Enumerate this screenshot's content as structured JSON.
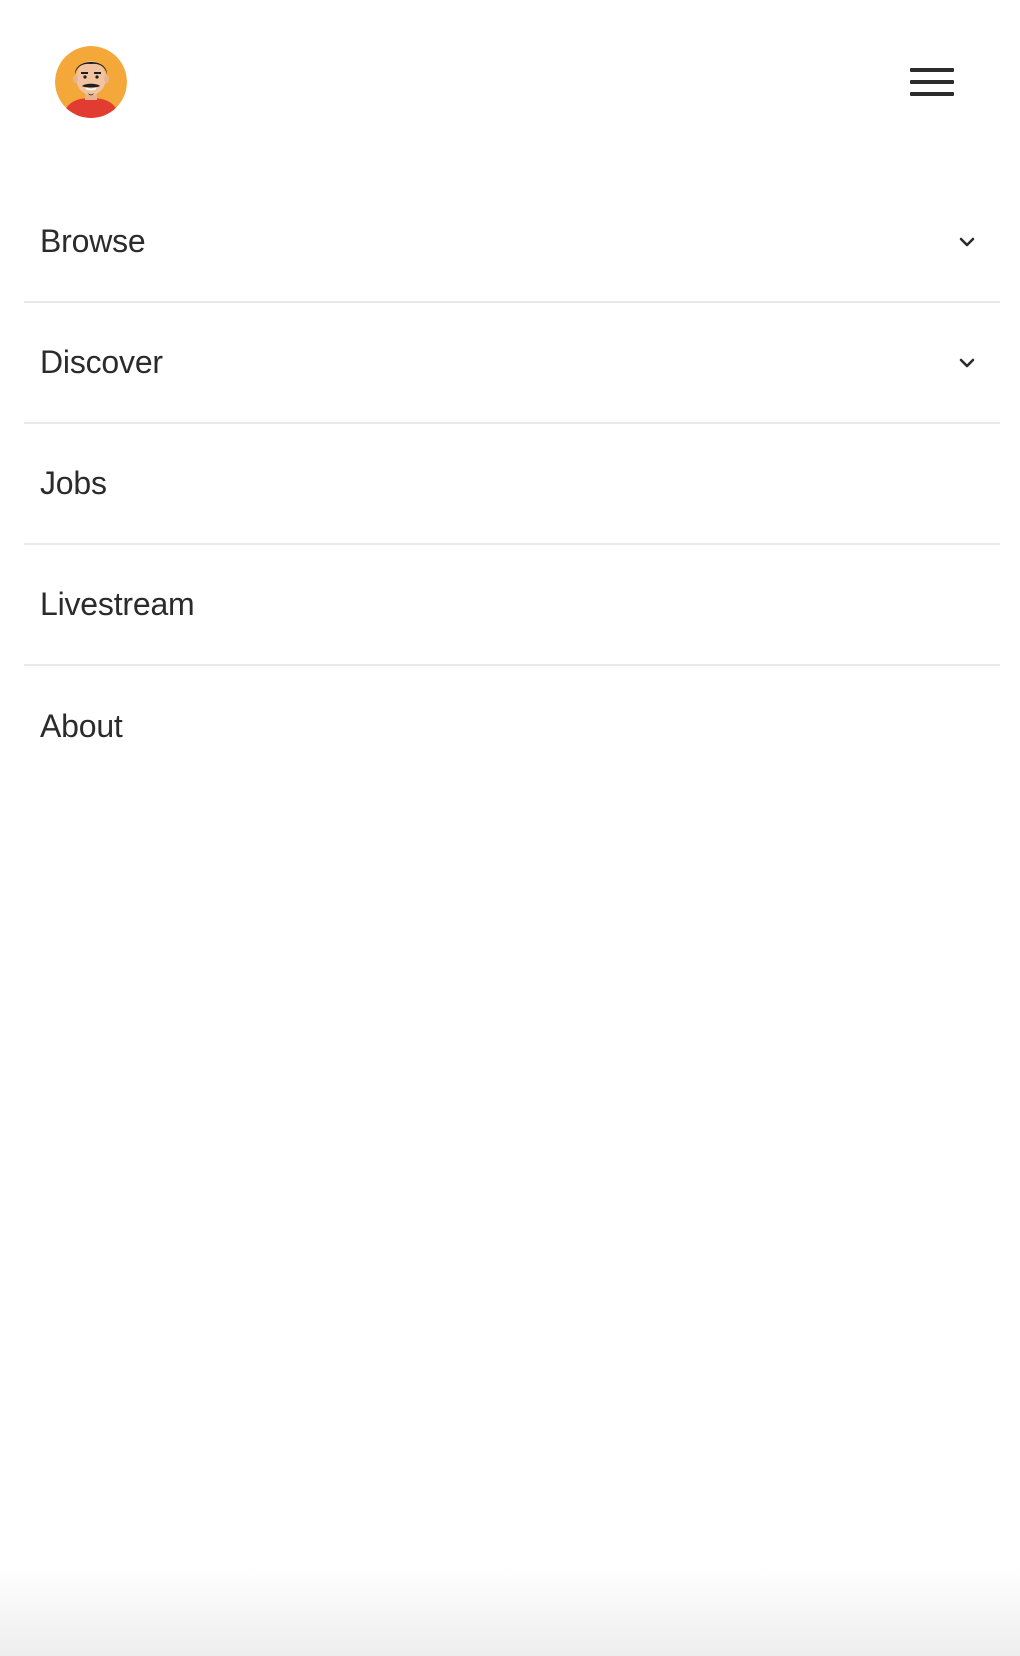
{
  "header": {
    "avatar_icon": "avatar-cartoon-face-icon",
    "menu_icon": "hamburger-menu-icon"
  },
  "nav": {
    "items": [
      {
        "label": "Browse",
        "has_dropdown": true,
        "icon": "chevron-down-icon"
      },
      {
        "label": "Discover",
        "has_dropdown": true,
        "icon": "chevron-down-icon"
      },
      {
        "label": "Jobs",
        "has_dropdown": false
      },
      {
        "label": "Livestream",
        "has_dropdown": false
      },
      {
        "label": "About",
        "has_dropdown": false
      }
    ]
  },
  "colors": {
    "avatar_background": "#F5A83A",
    "avatar_shirt": "#E23B32",
    "text": "#2b2b2b",
    "divider": "#e9e9e9",
    "icon": "#2b2b2b"
  }
}
